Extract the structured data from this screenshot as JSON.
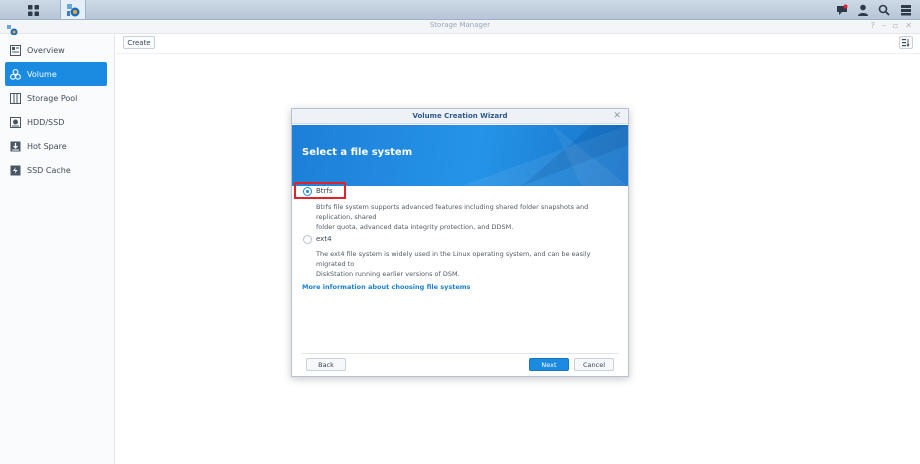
{
  "app": {
    "title": "Storage Manager"
  },
  "sidebar": {
    "items": [
      {
        "label": "Overview",
        "icon": "overview-icon"
      },
      {
        "label": "Volume",
        "icon": "volume-icon",
        "active": true
      },
      {
        "label": "Storage Pool",
        "icon": "storage-pool-icon"
      },
      {
        "label": "HDD/SSD",
        "icon": "hdd-icon"
      },
      {
        "label": "Hot Spare",
        "icon": "hot-spare-icon"
      },
      {
        "label": "SSD Cache",
        "icon": "ssd-cache-icon"
      }
    ]
  },
  "toolbar": {
    "create_label": "Create"
  },
  "dialog": {
    "title": "Volume Creation Wizard",
    "heading": "Select a file system",
    "options": [
      {
        "label": "Btrfs",
        "selected": true,
        "desc_line1": "Btrfs file system supports advanced features including shared folder snapshots and replication, shared",
        "desc_line2": "folder quota, advanced data integrity protection, and DDSM."
      },
      {
        "label": "ext4",
        "selected": false,
        "desc_line1": "The ext4 file system is widely used in the Linux operating system, and can be easily migrated to",
        "desc_line2": "DiskStation running earlier versions of DSM."
      }
    ],
    "more_link": "More information about choosing file systems",
    "back_label": "Back",
    "next_label": "Next",
    "cancel_label": "Cancel"
  },
  "colors": {
    "accent": "#1a8be0",
    "highlight": "#e0232a",
    "banner": "#1d7fd7"
  }
}
